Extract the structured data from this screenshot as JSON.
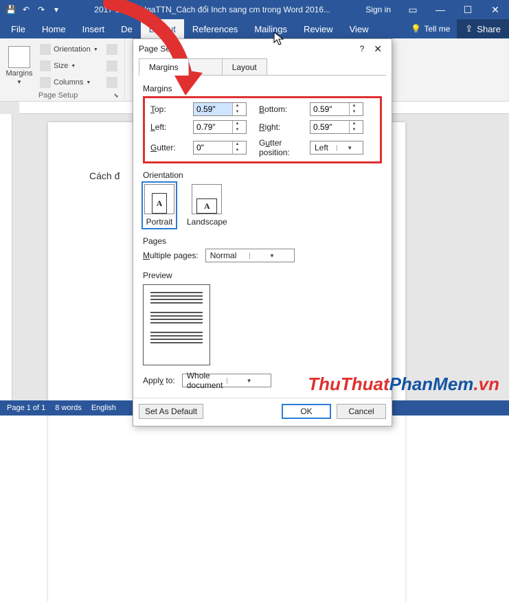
{
  "titlebar": {
    "title": "2017-11-30_NgaTTN_Cách đổi Inch sang cm trong Word 2016...",
    "signin": "Sign in"
  },
  "ribbon_tabs": {
    "file": "File",
    "home": "Home",
    "insert": "Insert",
    "design": "De",
    "layout": "Layout",
    "references": "References",
    "mailings": "Mailings",
    "review": "Review",
    "view": "View",
    "tellme": "Tell me",
    "share": "Share"
  },
  "ribbon": {
    "margins": "Margins",
    "orientation": "Orientation",
    "size": "Size",
    "columns": "Columns",
    "page_setup": "Page Setup"
  },
  "document": {
    "text": "Cách đ"
  },
  "statusbar": {
    "page": "Page 1 of 1",
    "words": "8 words",
    "lang": "English"
  },
  "dialog": {
    "title": "Page Set",
    "tabs": {
      "margins": "Margins",
      "paper": "",
      "layout": "Layout"
    },
    "section_margins": "Margins",
    "labels": {
      "top": "Top:",
      "bottom": "Bottom:",
      "left": "Left:",
      "right": "Right:",
      "gutter": "Gutter:",
      "gutter_pos": "Gutter position:"
    },
    "values": {
      "top": "0.59\"",
      "bottom": "0.59\"",
      "left": "0.79\"",
      "right": "0.59\"",
      "gutter": "0\"",
      "gutter_pos": "Left"
    },
    "orientation_label": "Orientation",
    "portrait": "Portrait",
    "landscape": "Landscape",
    "pages_label": "Pages",
    "multiple_pages": "Multiple pages:",
    "multiple_pages_val": "Normal",
    "preview_label": "Preview",
    "apply_to": "Apply to:",
    "apply_to_val": "Whole document",
    "set_default": "Set As Default",
    "ok": "OK",
    "cancel": "Cancel"
  },
  "watermark": {
    "a": "ThuThuat",
    "b": "PhanMem",
    "c": ".vn"
  }
}
